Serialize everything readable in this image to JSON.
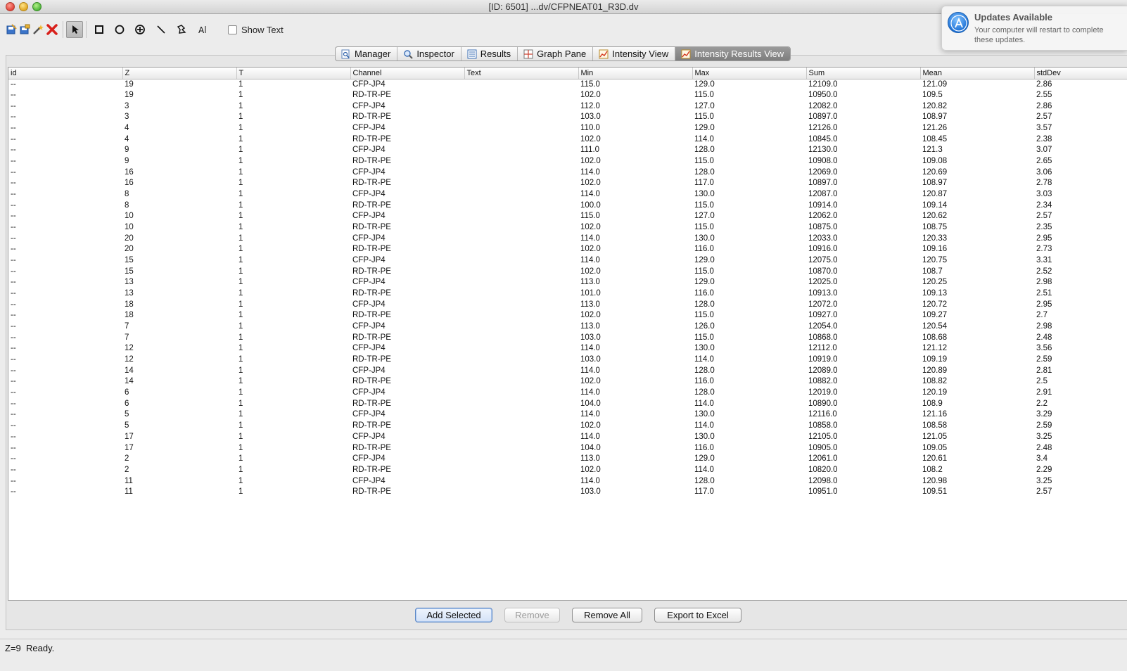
{
  "window": {
    "title": "[ID: 6501] ...dv/CFPNEAT01_R3D.dv"
  },
  "toolbar": {
    "tools": [
      "save-roi-icon",
      "save-as-icon",
      "magic-wand-icon",
      "delete-icon",
      "pointer-icon",
      "rectangle-icon",
      "ellipse-icon",
      "point-icon",
      "line-icon",
      "polygon-icon",
      "text-icon"
    ],
    "show_text_label": "Show Text",
    "show_text_checked": false
  },
  "notification": {
    "title": "Updates Available",
    "body": "Your computer will restart to complete these updates."
  },
  "tabs": [
    {
      "label": "Manager",
      "icon": "magnifier-doc-icon",
      "active": false
    },
    {
      "label": "Inspector",
      "icon": "magnifier-icon",
      "active": false
    },
    {
      "label": "Results",
      "icon": "list-icon",
      "active": false
    },
    {
      "label": "Graph Pane",
      "icon": "grid-icon",
      "active": false
    },
    {
      "label": "Intensity View",
      "icon": "chart-icon",
      "active": false
    },
    {
      "label": "Intensity Results View",
      "icon": "chart-icon",
      "active": true
    }
  ],
  "table": {
    "columns": [
      "id",
      "Z",
      "T",
      "Channel",
      "Text",
      "Min",
      "Max",
      "Sum",
      "Mean",
      "stdDev"
    ],
    "rows": [
      [
        "--",
        "19",
        "1",
        "CFP-JP4",
        "",
        "115.0",
        "129.0",
        "12109.0",
        "121.09",
        "2.86"
      ],
      [
        "--",
        "19",
        "1",
        "RD-TR-PE",
        "",
        "102.0",
        "115.0",
        "10950.0",
        "109.5",
        "2.55"
      ],
      [
        "--",
        "3",
        "1",
        "CFP-JP4",
        "",
        "112.0",
        "127.0",
        "12082.0",
        "120.82",
        "2.86"
      ],
      [
        "--",
        "3",
        "1",
        "RD-TR-PE",
        "",
        "103.0",
        "115.0",
        "10897.0",
        "108.97",
        "2.57"
      ],
      [
        "--",
        "4",
        "1",
        "CFP-JP4",
        "",
        "110.0",
        "129.0",
        "12126.0",
        "121.26",
        "3.57"
      ],
      [
        "--",
        "4",
        "1",
        "RD-TR-PE",
        "",
        "102.0",
        "114.0",
        "10845.0",
        "108.45",
        "2.38"
      ],
      [
        "--",
        "9",
        "1",
        "CFP-JP4",
        "",
        "111.0",
        "128.0",
        "12130.0",
        "121.3",
        "3.07"
      ],
      [
        "--",
        "9",
        "1",
        "RD-TR-PE",
        "",
        "102.0",
        "115.0",
        "10908.0",
        "109.08",
        "2.65"
      ],
      [
        "--",
        "16",
        "1",
        "CFP-JP4",
        "",
        "114.0",
        "128.0",
        "12069.0",
        "120.69",
        "3.06"
      ],
      [
        "--",
        "16",
        "1",
        "RD-TR-PE",
        "",
        "102.0",
        "117.0",
        "10897.0",
        "108.97",
        "2.78"
      ],
      [
        "--",
        "8",
        "1",
        "CFP-JP4",
        "",
        "114.0",
        "130.0",
        "12087.0",
        "120.87",
        "3.03"
      ],
      [
        "--",
        "8",
        "1",
        "RD-TR-PE",
        "",
        "100.0",
        "115.0",
        "10914.0",
        "109.14",
        "2.34"
      ],
      [
        "--",
        "10",
        "1",
        "CFP-JP4",
        "",
        "115.0",
        "127.0",
        "12062.0",
        "120.62",
        "2.57"
      ],
      [
        "--",
        "10",
        "1",
        "RD-TR-PE",
        "",
        "102.0",
        "115.0",
        "10875.0",
        "108.75",
        "2.35"
      ],
      [
        "--",
        "20",
        "1",
        "CFP-JP4",
        "",
        "114.0",
        "130.0",
        "12033.0",
        "120.33",
        "2.95"
      ],
      [
        "--",
        "20",
        "1",
        "RD-TR-PE",
        "",
        "102.0",
        "116.0",
        "10916.0",
        "109.16",
        "2.73"
      ],
      [
        "--",
        "15",
        "1",
        "CFP-JP4",
        "",
        "114.0",
        "129.0",
        "12075.0",
        "120.75",
        "3.31"
      ],
      [
        "--",
        "15",
        "1",
        "RD-TR-PE",
        "",
        "102.0",
        "115.0",
        "10870.0",
        "108.7",
        "2.52"
      ],
      [
        "--",
        "13",
        "1",
        "CFP-JP4",
        "",
        "113.0",
        "129.0",
        "12025.0",
        "120.25",
        "2.98"
      ],
      [
        "--",
        "13",
        "1",
        "RD-TR-PE",
        "",
        "101.0",
        "116.0",
        "10913.0",
        "109.13",
        "2.51"
      ],
      [
        "--",
        "18",
        "1",
        "CFP-JP4",
        "",
        "113.0",
        "128.0",
        "12072.0",
        "120.72",
        "2.95"
      ],
      [
        "--",
        "18",
        "1",
        "RD-TR-PE",
        "",
        "102.0",
        "115.0",
        "10927.0",
        "109.27",
        "2.7"
      ],
      [
        "--",
        "7",
        "1",
        "CFP-JP4",
        "",
        "113.0",
        "126.0",
        "12054.0",
        "120.54",
        "2.98"
      ],
      [
        "--",
        "7",
        "1",
        "RD-TR-PE",
        "",
        "103.0",
        "115.0",
        "10868.0",
        "108.68",
        "2.48"
      ],
      [
        "--",
        "12",
        "1",
        "CFP-JP4",
        "",
        "114.0",
        "130.0",
        "12112.0",
        "121.12",
        "3.56"
      ],
      [
        "--",
        "12",
        "1",
        "RD-TR-PE",
        "",
        "103.0",
        "114.0",
        "10919.0",
        "109.19",
        "2.59"
      ],
      [
        "--",
        "14",
        "1",
        "CFP-JP4",
        "",
        "114.0",
        "128.0",
        "12089.0",
        "120.89",
        "2.81"
      ],
      [
        "--",
        "14",
        "1",
        "RD-TR-PE",
        "",
        "102.0",
        "116.0",
        "10882.0",
        "108.82",
        "2.5"
      ],
      [
        "--",
        "6",
        "1",
        "CFP-JP4",
        "",
        "114.0",
        "128.0",
        "12019.0",
        "120.19",
        "2.91"
      ],
      [
        "--",
        "6",
        "1",
        "RD-TR-PE",
        "",
        "104.0",
        "114.0",
        "10890.0",
        "108.9",
        "2.2"
      ],
      [
        "--",
        "5",
        "1",
        "CFP-JP4",
        "",
        "114.0",
        "130.0",
        "12116.0",
        "121.16",
        "3.29"
      ],
      [
        "--",
        "5",
        "1",
        "RD-TR-PE",
        "",
        "102.0",
        "114.0",
        "10858.0",
        "108.58",
        "2.59"
      ],
      [
        "--",
        "17",
        "1",
        "CFP-JP4",
        "",
        "114.0",
        "130.0",
        "12105.0",
        "121.05",
        "3.25"
      ],
      [
        "--",
        "17",
        "1",
        "RD-TR-PE",
        "",
        "104.0",
        "116.0",
        "10905.0",
        "109.05",
        "2.48"
      ],
      [
        "--",
        "2",
        "1",
        "CFP-JP4",
        "",
        "113.0",
        "129.0",
        "12061.0",
        "120.61",
        "3.4"
      ],
      [
        "--",
        "2",
        "1",
        "RD-TR-PE",
        "",
        "102.0",
        "114.0",
        "10820.0",
        "108.2",
        "2.29"
      ],
      [
        "--",
        "11",
        "1",
        "CFP-JP4",
        "",
        "114.0",
        "128.0",
        "12098.0",
        "120.98",
        "3.25"
      ],
      [
        "--",
        "11",
        "1",
        "RD-TR-PE",
        "",
        "103.0",
        "117.0",
        "10951.0",
        "109.51",
        "2.57"
      ]
    ]
  },
  "buttons": {
    "add_selected": "Add Selected",
    "remove": "Remove",
    "remove_all": "Remove All",
    "export": "Export to Excel"
  },
  "status": {
    "text": "Z=9  Ready."
  },
  "colors": {
    "accent": "#5b87c6",
    "active_tab": "#8a8a8a"
  }
}
